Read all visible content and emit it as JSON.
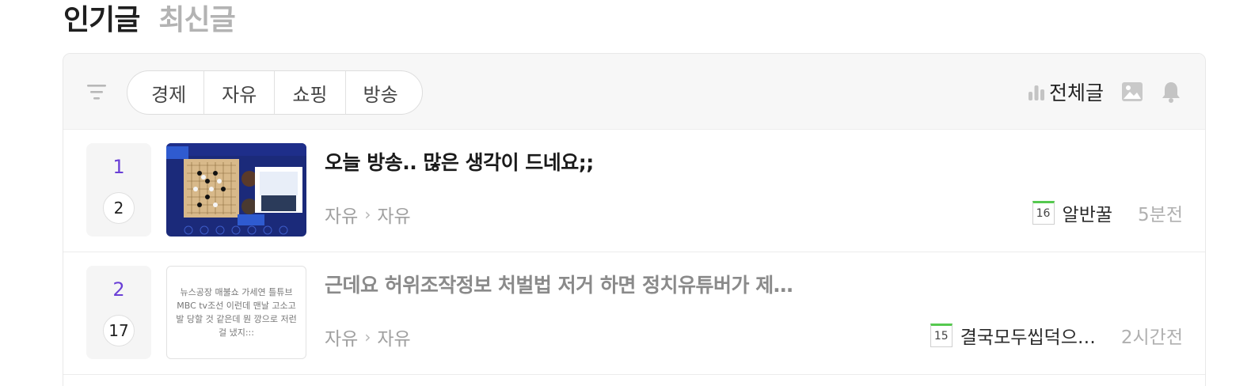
{
  "tabs": [
    {
      "label": "인기글",
      "active": true
    },
    {
      "label": "최신글",
      "active": false
    }
  ],
  "toolbar": {
    "filter_icon": "filter-icon",
    "categories": [
      "경제",
      "자유",
      "쇼핑",
      "방송"
    ],
    "all_posts_label": "전체글",
    "icons": [
      "bar-chart-icon",
      "image-icon",
      "bell-icon"
    ]
  },
  "posts": [
    {
      "rank": "1",
      "comment_count": "2",
      "thumbnail_type": "image",
      "title": "오늘 방송.. 많은 생각이 드네요;;",
      "board": "자유",
      "subboard": "자유",
      "level": "16",
      "author": "알반꿀",
      "time": "5분전"
    },
    {
      "rank": "2",
      "comment_count": "17",
      "thumbnail_type": "text",
      "thumbnail_text": "뉴스공장 매불쇼 가세연 틀튜브 MBC tv조선 이런데 맨날 고소고발 당할 것 같은데 뭔 깡으로 저런걸 냈지:::",
      "title": "근데요 허위조작정보 처벌법 저거 하면 정치유튜버가 제…",
      "board": "자유",
      "subboard": "자유",
      "level": "15",
      "author": "결국모두씹덕으…",
      "time": "2시간전"
    }
  ],
  "colors": {
    "rank": "#6a3fd6",
    "level_bar": "#55c94f",
    "toolbar_bg": "#f7f7f7"
  }
}
